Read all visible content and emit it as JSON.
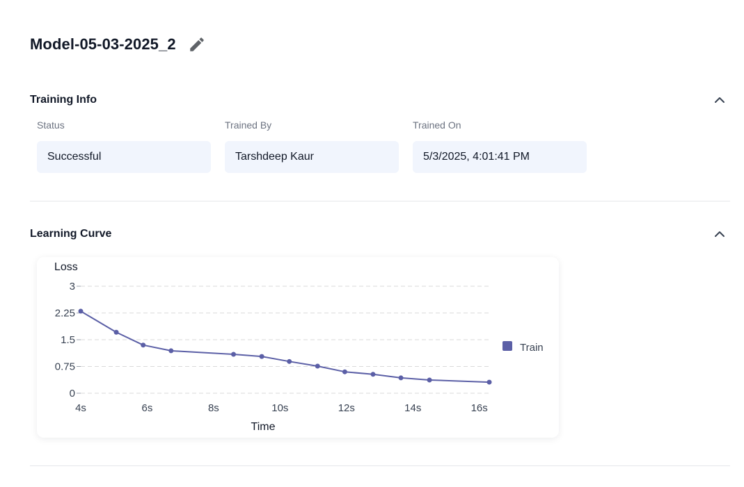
{
  "page": {
    "title": "Model-05-03-2025_2",
    "edit_icon": "pencil-icon"
  },
  "training_info": {
    "title": "Training Info",
    "collapse_icon": "chevron-up-icon",
    "fields": [
      {
        "label": "Status",
        "value": "Successful"
      },
      {
        "label": "Trained By",
        "value": "Tarshdeep Kaur"
      },
      {
        "label": "Trained On",
        "value": "5/3/2025, 4:01:41 PM"
      }
    ]
  },
  "learning_curve": {
    "title": "Learning Curve",
    "collapse_icon": "chevron-up-icon"
  },
  "colors": {
    "series": "#5b5fa6",
    "grid": "#d9d9d9",
    "field_bg": "#f1f5fd"
  },
  "chart_data": {
    "type": "line",
    "xlabel": "Time",
    "ylabel": "Loss",
    "xlim": [
      4,
      16.3
    ],
    "ylim": [
      0,
      3
    ],
    "x_ticks": [
      4,
      6,
      8,
      10,
      12,
      14,
      16
    ],
    "x_tick_labels": [
      "4s",
      "6s",
      "8s",
      "10s",
      "12s",
      "14s",
      "16s"
    ],
    "y_ticks": [
      0,
      0.75,
      1.5,
      2.25,
      3
    ],
    "y_tick_labels": [
      "0",
      "0.75",
      "1.5",
      "2.25",
      "3"
    ],
    "grid": true,
    "legend_position": "right",
    "series": [
      {
        "name": "Train",
        "x": [
          4.0,
          5.07,
          5.88,
          6.72,
          8.6,
          9.45,
          10.28,
          11.13,
          11.95,
          12.8,
          13.64,
          14.5,
          16.3
        ],
        "y": [
          2.3,
          1.71,
          1.35,
          1.19,
          1.09,
          1.03,
          0.89,
          0.76,
          0.6,
          0.53,
          0.43,
          0.37,
          0.31
        ]
      }
    ]
  }
}
